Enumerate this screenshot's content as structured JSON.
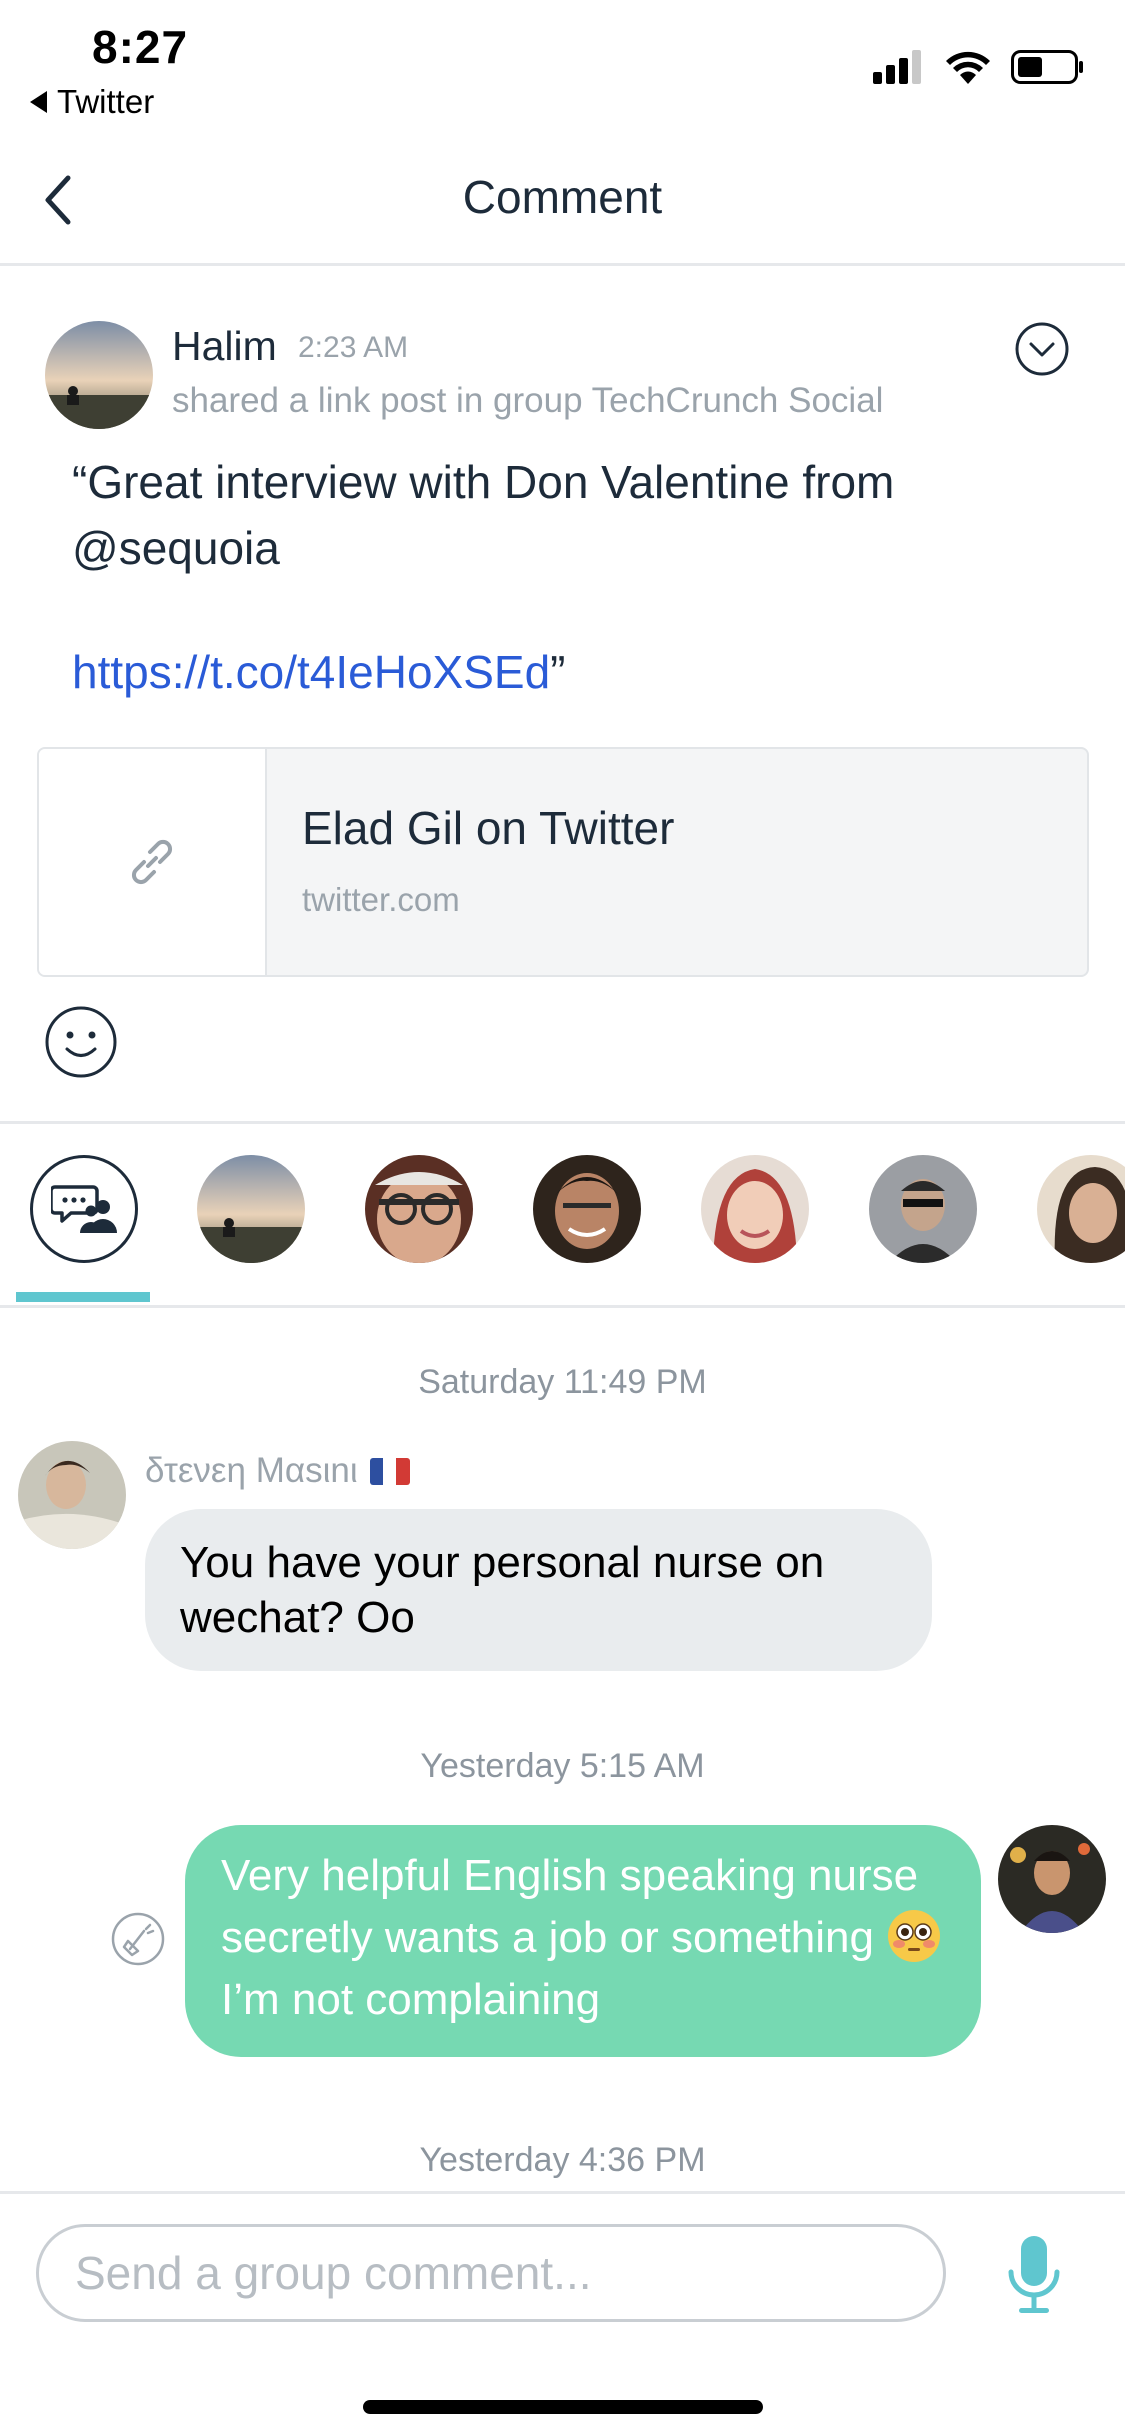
{
  "status_bar": {
    "time": "8:27",
    "back_app": "Twitter",
    "icons": [
      "cellular-signal-icon",
      "wifi-icon",
      "battery-icon"
    ]
  },
  "nav": {
    "title": "Comment",
    "back_icon": "chevron-left-icon"
  },
  "post": {
    "author": "Halim",
    "time": "2:23 AM",
    "meta": "shared a link post in group TechCrunch Social",
    "text": "“Great interview with Don Valentine from @sequoia",
    "link": "https://t.co/t4IeHoXSEd",
    "link_suffix": "”",
    "link_card": {
      "title": "Elad Gil on Twitter",
      "domain": "twitter.com",
      "icon": "link-icon"
    },
    "menu_icon": "chevron-down-circle-icon",
    "react_icon": "smiley-icon"
  },
  "participants": {
    "all_tab_icon": "group-chat-icon",
    "avatars": [
      "halim-avatar",
      "participant-avatar",
      "participant-avatar",
      "participant-avatar",
      "participant-avatar",
      "participant-avatar"
    ]
  },
  "chat": {
    "messages": [
      {
        "date": "Saturday 11:49 PM",
        "sender": "δτενεη Μαsιnι",
        "text": "You have your personal nurse on wechat? Oo"
      },
      {
        "date": "Yesterday 5:15 AM",
        "text_before": "Very helpful English speaking nurse  secretly wants a job or something",
        "emoji": "flushed-face-emoji",
        "text_after": "I’m not complaining"
      }
    ],
    "last_date": "Yesterday 4:36 PM"
  },
  "input": {
    "placeholder": "Send a group comment...",
    "value": "",
    "mic_icon": "microphone-icon"
  },
  "colors": {
    "accent_teal": "#5fc6cf",
    "outgoing_bubble": "#76d9b2",
    "incoming_bubble": "#e9ecee",
    "link_blue": "#2a5bd7",
    "text_dark": "#1d2b3a",
    "text_gray": "#9aa3ab"
  }
}
